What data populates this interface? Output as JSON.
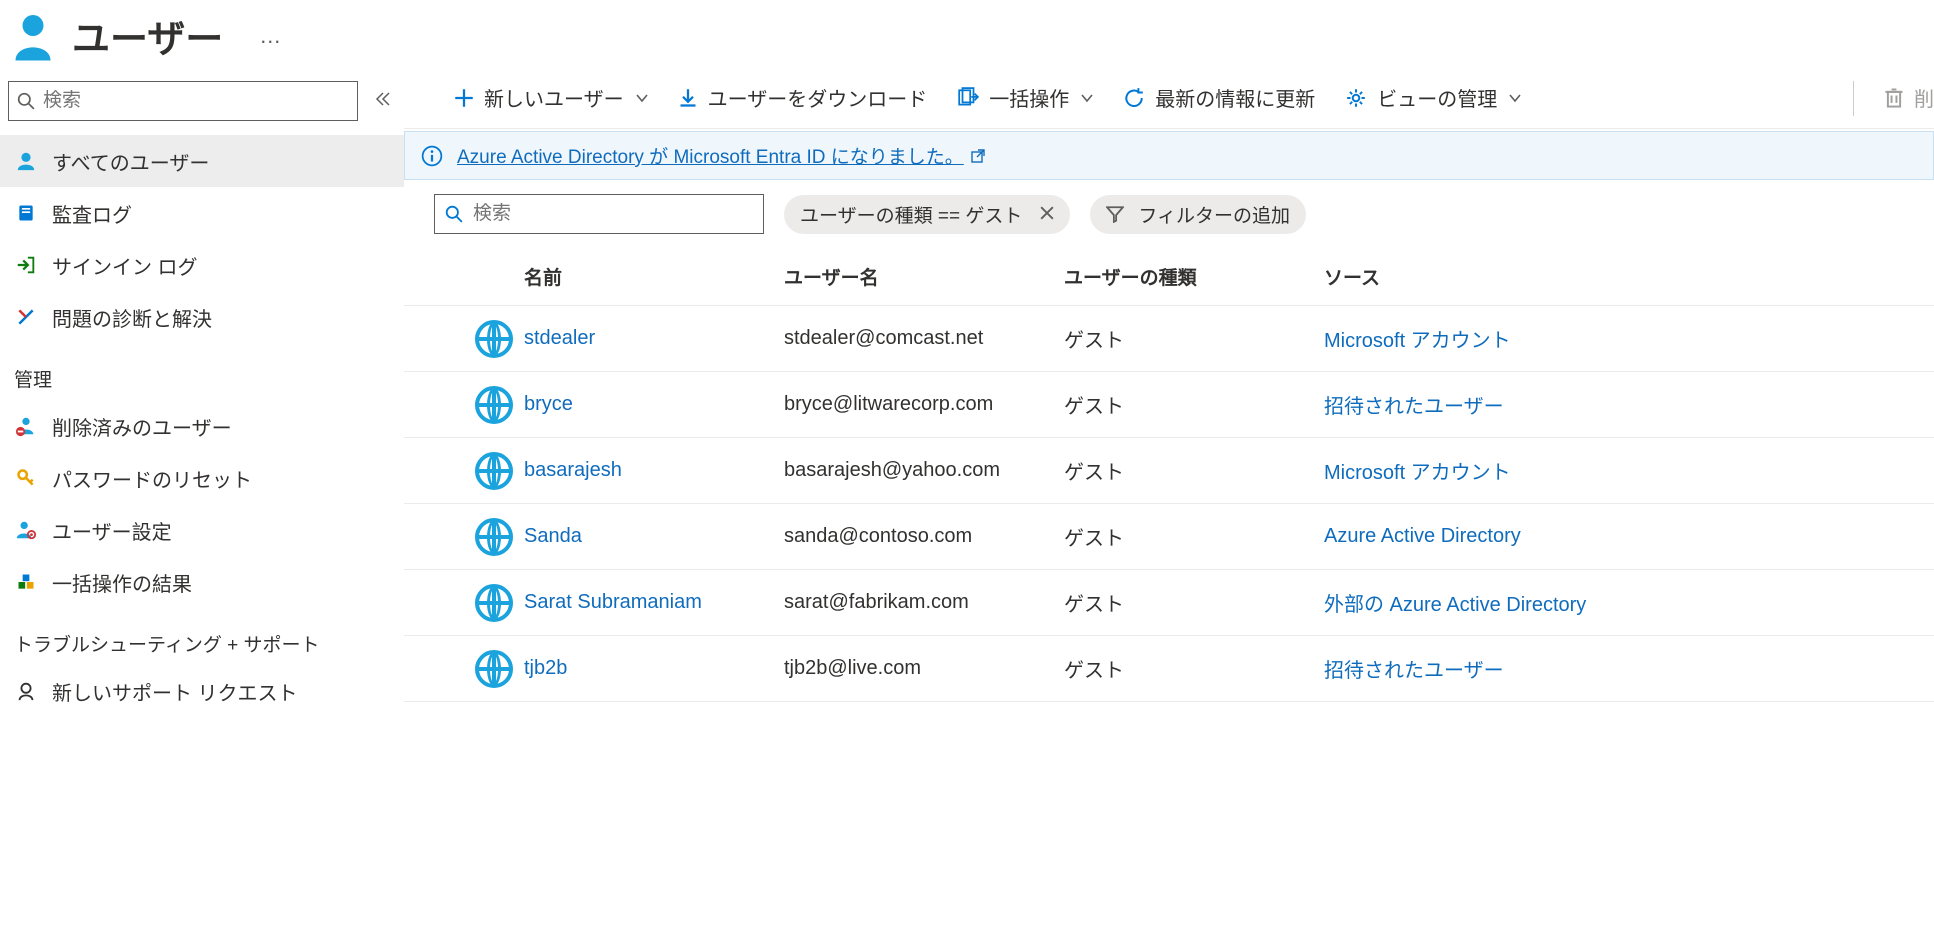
{
  "header": {
    "title": "ユーザー",
    "more": "…"
  },
  "sidebar": {
    "search_placeholder": "検索",
    "items_primary": [
      {
        "id": "all-users",
        "label": "すべてのユーザー"
      },
      {
        "id": "audit-logs",
        "label": "監査ログ"
      },
      {
        "id": "signin-logs",
        "label": "サインイン ログ"
      },
      {
        "id": "diagnose",
        "label": "問題の診断と解決"
      }
    ],
    "section_manage": "管理",
    "items_manage": [
      {
        "id": "deleted-users",
        "label": "削除済みのユーザー"
      },
      {
        "id": "pw-reset",
        "label": "パスワードのリセット"
      },
      {
        "id": "user-settings",
        "label": "ユーザー設定"
      },
      {
        "id": "bulk-results",
        "label": "一括操作の結果"
      }
    ],
    "section_support": "トラブルシューティング + サポート",
    "items_support": [
      {
        "id": "new-support",
        "label": "新しいサポート リクエスト"
      }
    ]
  },
  "toolbar": {
    "new_user": "新しいユーザー",
    "download_users": "ユーザーをダウンロード",
    "bulk_ops": "一括操作",
    "refresh": "最新の情報に更新",
    "manage_view": "ビューの管理",
    "delete": "削"
  },
  "banner": {
    "text": "Azure Active Directory が Microsoft Entra ID になりました。"
  },
  "filters": {
    "search_placeholder": "検索",
    "pill_user_type": "ユーザーの種類 == ゲスト",
    "add_filter": "フィルターの追加"
  },
  "table": {
    "cols": {
      "name": "名前",
      "user": "ユーザー名",
      "type": "ユーザーの種類",
      "src": "ソース"
    },
    "rows": [
      {
        "name": "stdealer",
        "user": "stdealer@comcast.net",
        "type": "ゲスト",
        "src": "Microsoft アカウント"
      },
      {
        "name": "bryce",
        "user": "bryce@litwarecorp.com",
        "type": "ゲスト",
        "src": "招待されたユーザー"
      },
      {
        "name": "basarajesh",
        "user": "basarajesh@yahoo.com",
        "type": "ゲスト",
        "src": "Microsoft アカウント"
      },
      {
        "name": "Sanda",
        "user": "sanda@contoso.com",
        "type": "ゲスト",
        "src": "Azure Active Directory"
      },
      {
        "name": "Sarat Subramaniam",
        "user": "sarat@fabrikam.com",
        "type": "ゲスト",
        "src": "外部の Azure Active Directory"
      },
      {
        "name": "tjb2b",
        "user": "tjb2b@live.com",
        "type": "ゲスト",
        "src": "招待されたユーザー"
      }
    ]
  }
}
